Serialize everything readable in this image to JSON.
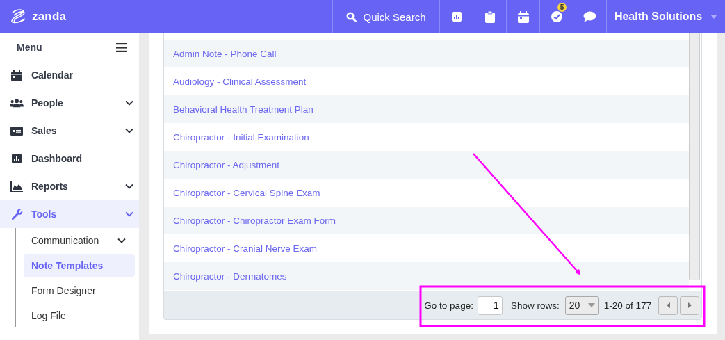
{
  "header": {
    "brand": "zanda",
    "quick_search": "Quick Search",
    "tools": [
      {
        "kind": "chart"
      },
      {
        "kind": "clipboard"
      },
      {
        "kind": "calendar"
      },
      {
        "kind": "tasks",
        "badge": "5"
      },
      {
        "kind": "chat"
      }
    ],
    "account": "Health Solutions"
  },
  "sidebar": {
    "title": "Menu",
    "items": [
      {
        "label": "Calendar",
        "kind": "calendar",
        "has_submenu": false,
        "selected": false
      },
      {
        "label": "People",
        "kind": "people",
        "has_submenu": true,
        "selected": false
      },
      {
        "label": "Sales",
        "kind": "sales",
        "has_submenu": true,
        "selected": false
      },
      {
        "label": "Dashboard",
        "kind": "chart",
        "has_submenu": false,
        "selected": false
      },
      {
        "label": "Reports",
        "kind": "area",
        "has_submenu": true,
        "selected": false
      },
      {
        "label": "Tools",
        "kind": "wrench",
        "has_submenu": true,
        "selected": true,
        "children": [
          {
            "label": "Communication",
            "has_submenu": true,
            "selected": false
          },
          {
            "label": "Note Templates",
            "has_submenu": false,
            "selected": true
          },
          {
            "label": "Form Designer",
            "has_submenu": false,
            "selected": false
          },
          {
            "label": "Log File",
            "has_submenu": false,
            "selected": false
          }
        ]
      }
    ]
  },
  "table": {
    "rows": [
      "Admin Note - Phone Call",
      "Audiology - Clinical Assessment",
      "Behavioral Health Treatment Plan",
      "Chiropractor - Initial Examination",
      "Chiropractor - Adjustment",
      "Chiropractor - Cervical Spine Exam",
      "Chiropractor - Chiropractor Exam Form",
      "Chiropractor - Cranial Nerve Exam",
      "Chiropractor - Dermatomes"
    ]
  },
  "pager": {
    "go_to_label": "Go to page:",
    "page": "1",
    "show_rows_label": "Show rows:",
    "rows": "20",
    "range": "1-20 of 177"
  }
}
